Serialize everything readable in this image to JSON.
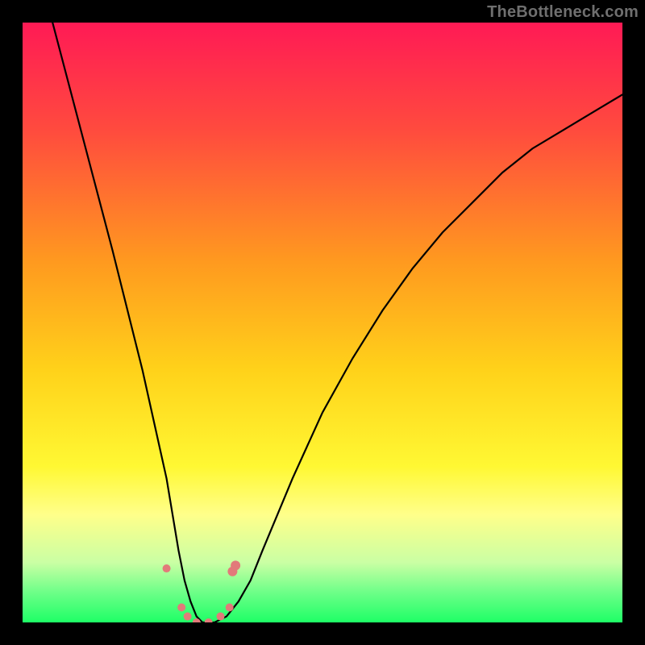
{
  "watermark": "TheBottleneck.com",
  "chart_data": {
    "type": "line",
    "title": "",
    "xlabel": "",
    "ylabel": "",
    "xlim": [
      0,
      100
    ],
    "ylim": [
      0,
      100
    ],
    "grid": false,
    "legend": false,
    "background_gradient_stops": [
      {
        "offset": 0.0,
        "color": "#ff1a55"
      },
      {
        "offset": 0.18,
        "color": "#ff4b3e"
      },
      {
        "offset": 0.4,
        "color": "#ff9a1f"
      },
      {
        "offset": 0.58,
        "color": "#ffd21a"
      },
      {
        "offset": 0.74,
        "color": "#fff833"
      },
      {
        "offset": 0.82,
        "color": "#ffff8a"
      },
      {
        "offset": 0.9,
        "color": "#caffa4"
      },
      {
        "offset": 0.95,
        "color": "#6dff88"
      },
      {
        "offset": 1.0,
        "color": "#1eff66"
      }
    ],
    "series": [
      {
        "name": "bottleneck-curve",
        "x": [
          5,
          10,
          15,
          18,
          20,
          22,
          24,
          25,
          26,
          27,
          28,
          29,
          30,
          32,
          34,
          36,
          38,
          40,
          45,
          50,
          55,
          60,
          65,
          70,
          75,
          80,
          85,
          90,
          95,
          100
        ],
        "values": [
          100,
          81,
          62,
          50,
          42,
          33,
          24,
          18,
          12,
          7,
          3.5,
          1,
          0,
          0,
          1,
          3.5,
          7,
          12,
          24,
          35,
          44,
          52,
          59,
          65,
          70,
          75,
          79,
          82,
          85,
          88
        ]
      }
    ],
    "markers": {
      "name": "highlight-points",
      "color": "#e27a7a",
      "points": [
        {
          "x": 24.0,
          "y": 9.0,
          "r": 5
        },
        {
          "x": 26.5,
          "y": 2.5,
          "r": 5
        },
        {
          "x": 27.5,
          "y": 1.0,
          "r": 5
        },
        {
          "x": 29.0,
          "y": 0.0,
          "r": 5
        },
        {
          "x": 31.0,
          "y": 0.0,
          "r": 5
        },
        {
          "x": 33.0,
          "y": 1.0,
          "r": 5
        },
        {
          "x": 34.5,
          "y": 2.5,
          "r": 5
        },
        {
          "x": 35.0,
          "y": 8.5,
          "r": 6
        },
        {
          "x": 35.5,
          "y": 9.5,
          "r": 6
        }
      ]
    }
  }
}
